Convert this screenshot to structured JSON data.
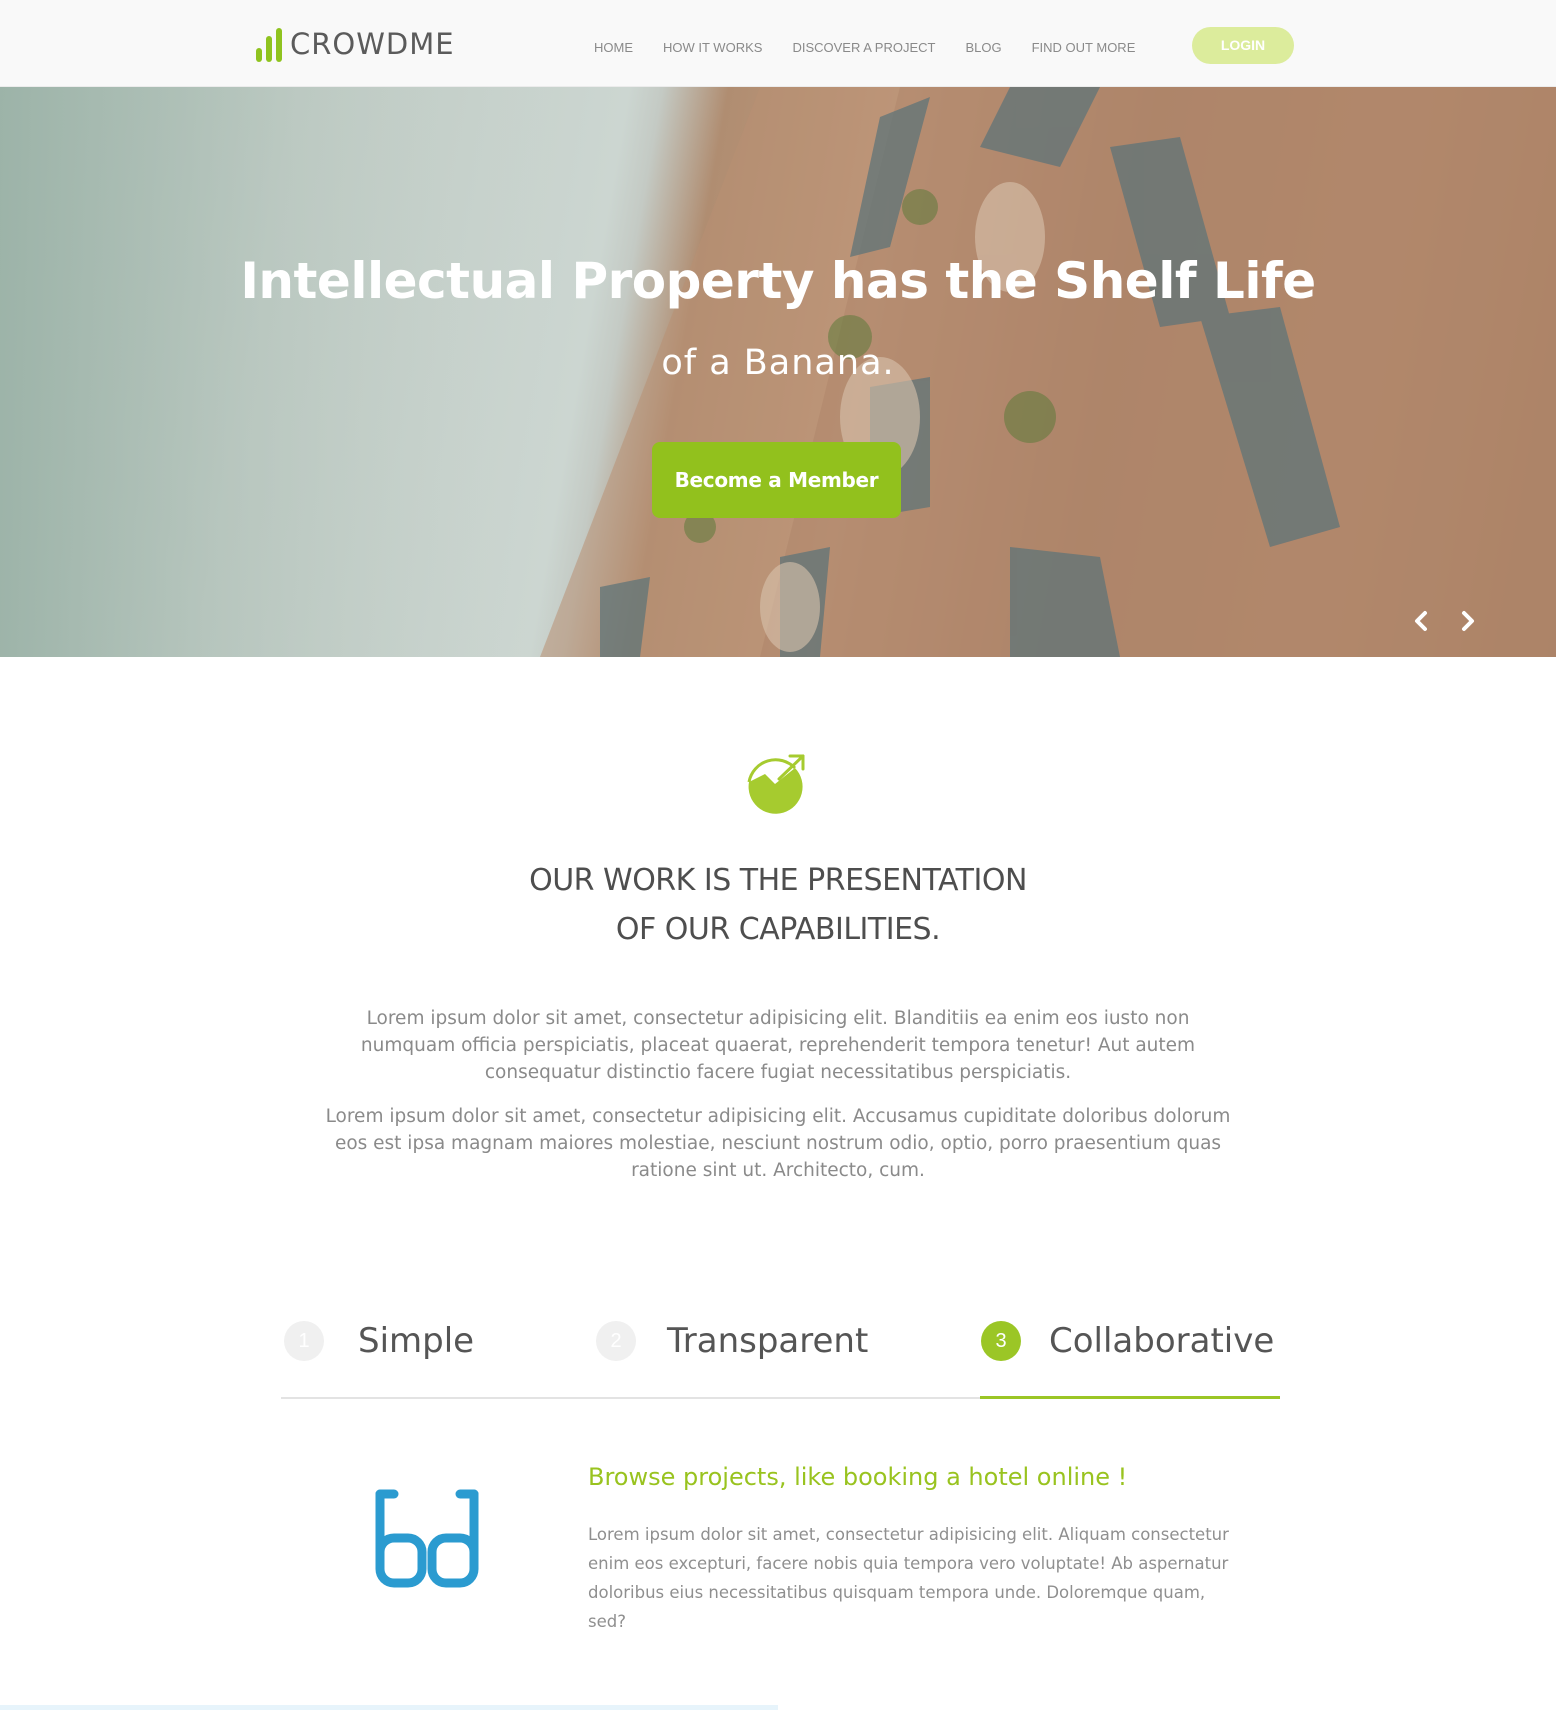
{
  "brand": {
    "name": "CROWDME",
    "color": "#8fc31f"
  },
  "nav": {
    "items": [
      "HOME",
      "HOW IT WORKS",
      "DISCOVER A PROJECT",
      "BLOG",
      "FIND OUT MORE"
    ],
    "login_label": "LOGIN"
  },
  "hero": {
    "title": "Intellectual Property has the Shelf Life",
    "subtitle": "of a Banana.",
    "cta_label": "Become a Member",
    "prev_icon": "chevron-left-icon",
    "next_icon": "chevron-right-icon"
  },
  "about": {
    "icon": "growth-chart-icon",
    "heading_line1": "OUR WORK IS THE PRESENTATION",
    "heading_line2": "OF OUR CAPABILITIES.",
    "paragraph1": "Lorem ipsum dolor sit amet, consectetur adipisicing elit. Blanditiis ea enim eos iusto non numquam officia perspiciatis, placeat quaerat, reprehenderit tempora tenetur! Aut autem consequatur distinctio facere fugiat necessitatibus perspiciatis.",
    "paragraph2": "Lorem ipsum dolor sit amet, consectetur adipisicing elit. Accusamus cupiditate doloribus dolorum eos est ipsa magnam maiores molestiae, nesciunt nostrum odio, optio, porro praesentium quas ratione sint ut. Architecto, cum."
  },
  "tabs": {
    "items": [
      {
        "number": "1",
        "label": "Simple"
      },
      {
        "number": "2",
        "label": "Transparent"
      },
      {
        "number": "3",
        "label": "Collaborative"
      }
    ],
    "active_index": 2,
    "accent_color": "#9bc626"
  },
  "feature": {
    "icon": "glasses-icon",
    "title": "Browse projects, like booking a hotel online !",
    "text": "Lorem ipsum dolor sit amet, consectetur adipisicing elit. Aliquam consectetur enim eos excepturi, facere nobis quia tempora vero voluptate! Ab aspernatur doloribus eius necessitatibus quisquam tempora unde. Doloremque quam, sed?"
  }
}
